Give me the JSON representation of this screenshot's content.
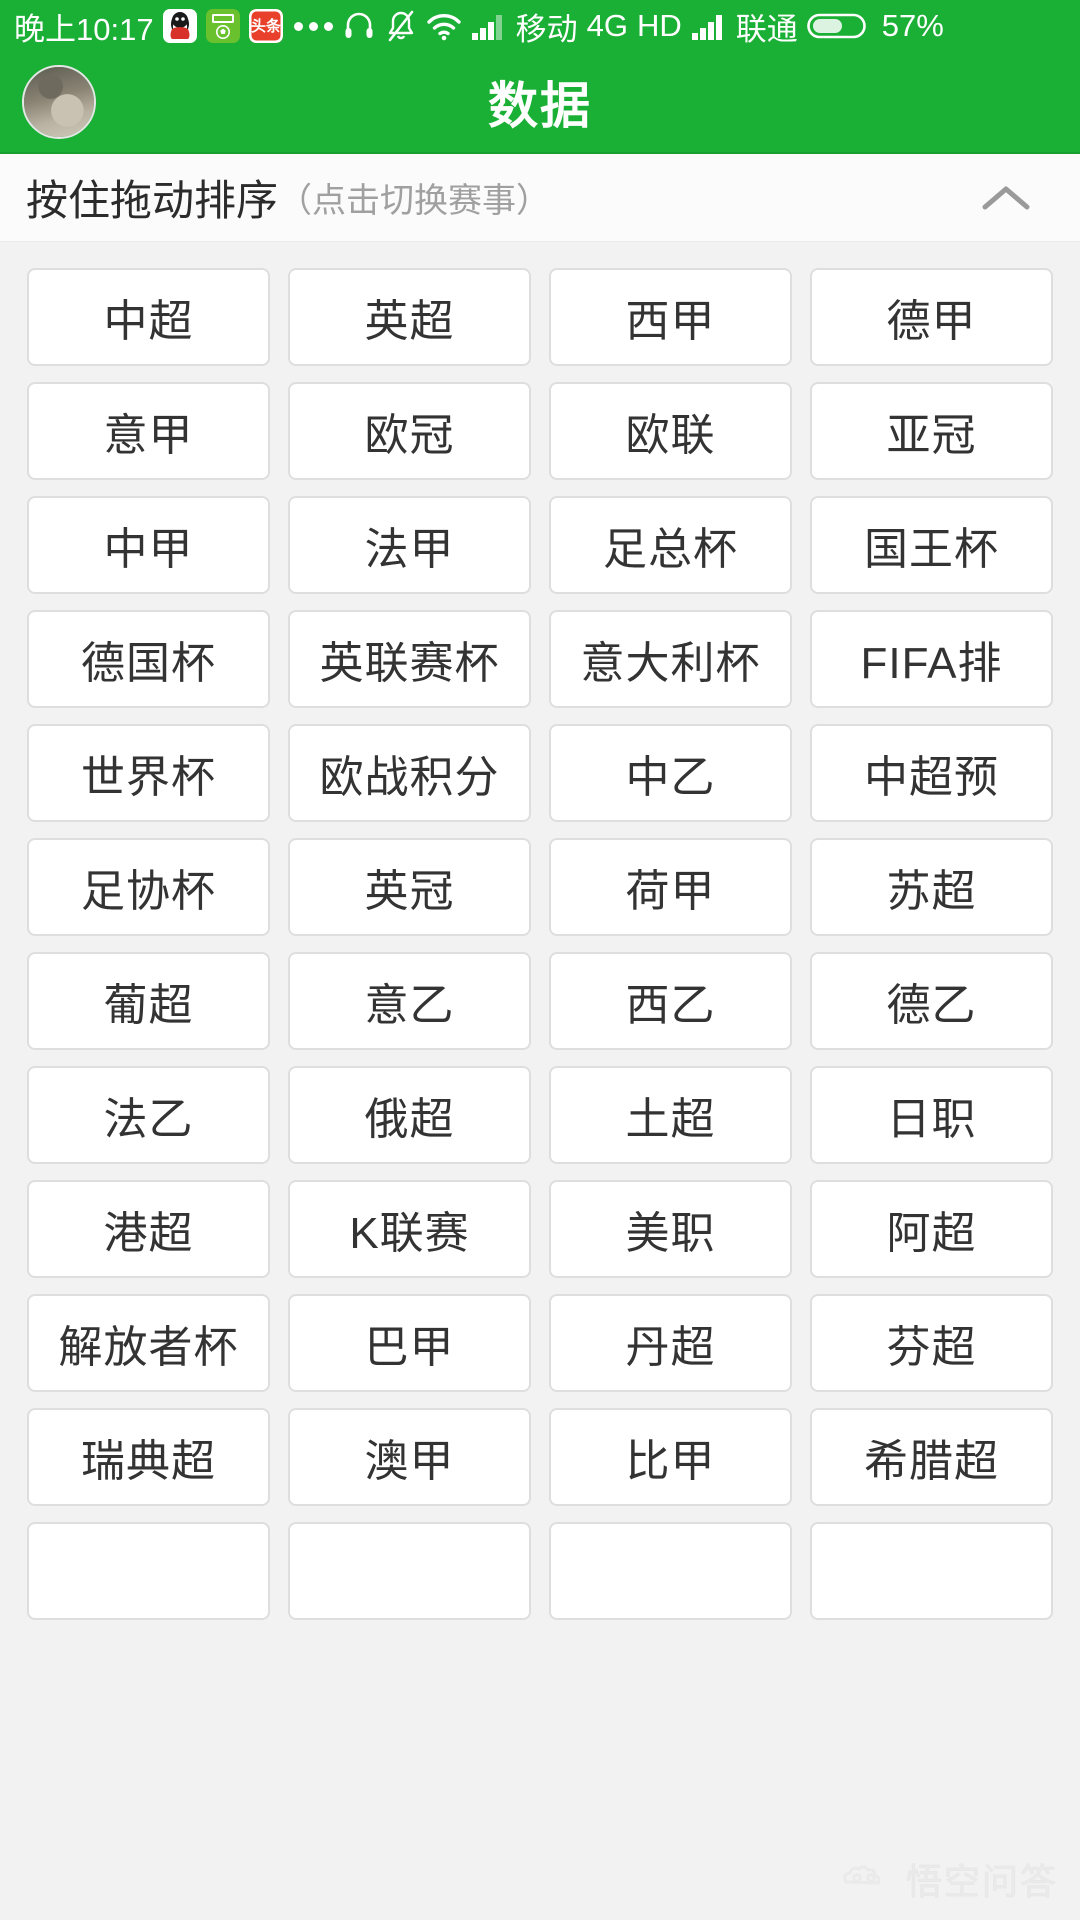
{
  "status_bar": {
    "time": "晚上10:17",
    "app_icons": [
      "qq-icon",
      "football-app-icon",
      "toutiao-icon"
    ],
    "overflow": "more-apps-dots-icon",
    "icons": [
      "headphone-icon",
      "bell-muted-icon",
      "wifi-icon",
      "signal-bars-icon"
    ],
    "carrier_primary": "移动",
    "network_type": "4G",
    "hd_label": "HD",
    "carrier_secondary": "联通",
    "battery_percent": "57%"
  },
  "header": {
    "title": "数据",
    "avatar": "user-avatar",
    "background_color": "#1aaf35"
  },
  "sort_bar": {
    "main_label": "按住拖动排序",
    "sub_label": "（点击切换赛事）",
    "collapse_icon": "chevron-up-icon"
  },
  "grid": {
    "columns": 4,
    "items": [
      "中超",
      "英超",
      "西甲",
      "德甲",
      "意甲",
      "欧冠",
      "欧联",
      "亚冠",
      "中甲",
      "法甲",
      "足总杯",
      "国王杯",
      "德国杯",
      "英联赛杯",
      "意大利杯",
      "FIFA排",
      "世界杯",
      "欧战积分",
      "中乙",
      "中超预",
      "足协杯",
      "英冠",
      "荷甲",
      "苏超",
      "葡超",
      "意乙",
      "西乙",
      "德乙",
      "法乙",
      "俄超",
      "土超",
      "日职",
      "港超",
      "K联赛",
      "美职",
      "阿超",
      "解放者杯",
      "巴甲",
      "丹超",
      "芬超",
      "瑞典超",
      "澳甲",
      "比甲",
      "希腊超",
      "",
      "",
      "",
      ""
    ]
  },
  "watermark": {
    "text": "悟空问答",
    "logo": "wukong-cloud-icon"
  },
  "colors": {
    "brand_green": "#1aaf35",
    "page_background": "#f2f2f2",
    "chip_background": "#ffffff",
    "chip_border": "#dedede",
    "chip_text": "#333333",
    "muted_text": "#a0a0a0"
  }
}
